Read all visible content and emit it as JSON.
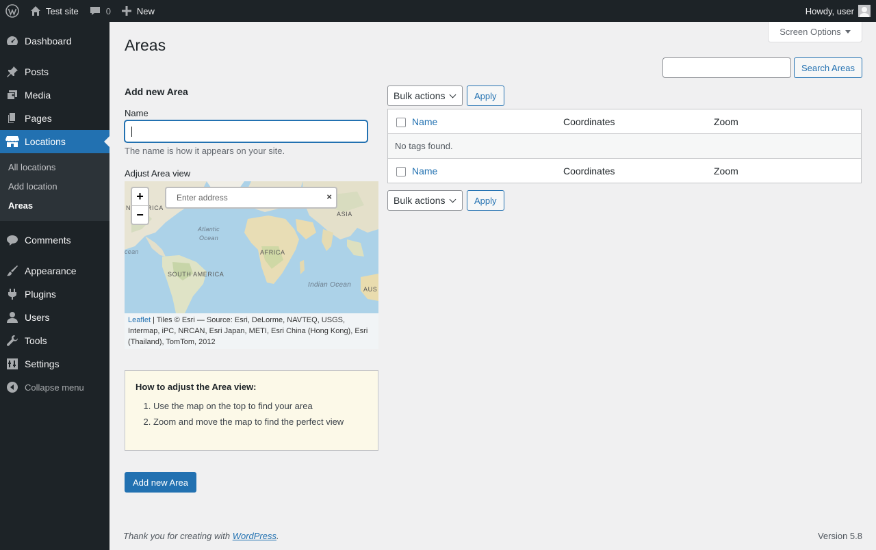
{
  "adminbar": {
    "site_name": "Test site",
    "comments_count": "0",
    "new_label": "New",
    "howdy": "Howdy, user"
  },
  "sidebar": {
    "items": [
      {
        "label": "Dashboard",
        "icon": "dashboard-icon"
      },
      {
        "label": "Posts",
        "icon": "pin-icon"
      },
      {
        "label": "Media",
        "icon": "media-icon"
      },
      {
        "label": "Pages",
        "icon": "page-icon"
      },
      {
        "label": "Locations",
        "icon": "store-icon",
        "current": true
      },
      {
        "label": "Comments",
        "icon": "comment-icon"
      },
      {
        "label": "Appearance",
        "icon": "brush-icon"
      },
      {
        "label": "Plugins",
        "icon": "plugin-icon"
      },
      {
        "label": "Users",
        "icon": "user-icon"
      },
      {
        "label": "Tools",
        "icon": "wrench-icon"
      },
      {
        "label": "Settings",
        "icon": "settings-icon"
      }
    ],
    "submenu": [
      "All locations",
      "Add location",
      "Areas"
    ],
    "collapse": "Collapse menu"
  },
  "screen_options": "Screen Options",
  "page_title": "Areas",
  "search": {
    "button": "Search Areas",
    "value": ""
  },
  "form": {
    "heading": "Add new Area",
    "name_label": "Name",
    "name_value": "",
    "name_desc": "The name is how it appears on your site.",
    "map_label": "Adjust Area view",
    "map": {
      "zoom_in": "+",
      "zoom_out": "−",
      "search_placeholder": "Enter address",
      "search_close": "×",
      "labels": {
        "n_america": "N AMERICA",
        "asia": "ASIA",
        "atlantic": "Atlantic",
        "ocean": "Ocean",
        "ocean_partial": "cean",
        "africa": "AFRICA",
        "s_america": "SOUTH AMERICA",
        "indian": "Indian Ocean",
        "aus": "AUS"
      },
      "attribution_link": "Leaflet",
      "attribution_text": " | Tiles © Esri — Source: Esri, DeLorme, NAVTEQ, USGS, Intermap, iPC, NRCAN, Esri Japan, METI, Esri China (Hong Kong), Esri (Thailand), TomTom, 2012"
    },
    "help": {
      "title": "How to adjust the Area view:",
      "steps": [
        "Use the map on the top to find your area",
        "Zoom and move the map to find the perfect view"
      ]
    },
    "submit": "Add new Area"
  },
  "table": {
    "bulk_actions": "Bulk actions",
    "apply": "Apply",
    "columns": [
      "Name",
      "Coordinates",
      "Zoom"
    ],
    "empty": "No tags found."
  },
  "footer": {
    "text_before": "Thank you for creating with ",
    "link": "WordPress",
    "text_after": ".",
    "version": "Version 5.8"
  }
}
